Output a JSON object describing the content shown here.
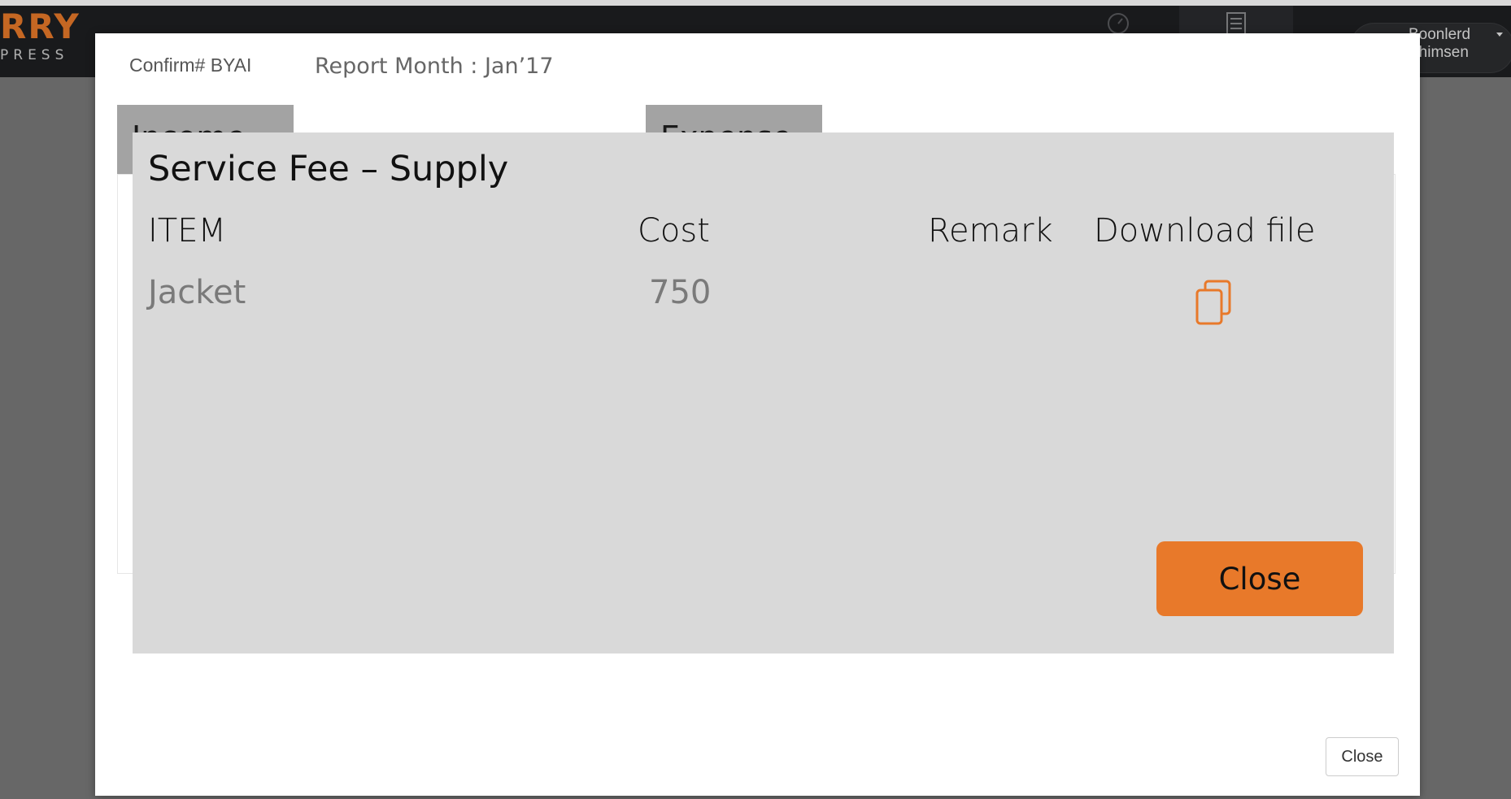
{
  "app": {
    "logo_text": "RRY",
    "logo_subtext": "PRESS",
    "user_name": "Boonlerd Phimsen"
  },
  "modal": {
    "confirm_label": "Confirm# BYAI",
    "report_month": "Report Month : Jan’17",
    "tabs": [
      {
        "label": "Income"
      },
      {
        "label": "Expense"
      }
    ],
    "close_label": "Close"
  },
  "dialog": {
    "title": "Service Fee – Supply",
    "columns": [
      "ITEM",
      "Cost",
      "Remark",
      "Download file"
    ],
    "rows": [
      {
        "item": "Jacket",
        "cost": "750",
        "remark": "",
        "download_icon": "copy-files-icon"
      }
    ],
    "close_label": "Close"
  },
  "colors": {
    "accent": "#e8792a",
    "dialog_bg": "#d9d9d9",
    "tab_bg": "#a3a3a3",
    "topbar_bg": "#1e1f21"
  }
}
